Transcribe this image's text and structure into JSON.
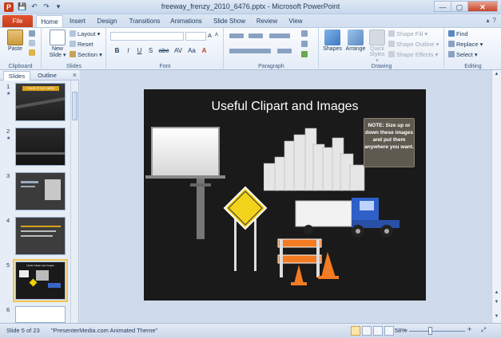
{
  "window": {
    "title": "freeway_frenzy_2010_6476.pptx - Microsoft PowerPoint",
    "app_icon": "P",
    "controls": [
      "—",
      "▢",
      "✕"
    ]
  },
  "qat": [
    "save-icon",
    "undo-icon",
    "redo-icon",
    "customize-icon"
  ],
  "tabs": {
    "file": "File",
    "items": [
      "Home",
      "Insert",
      "Design",
      "Transitions",
      "Animations",
      "Slide Show",
      "Review",
      "View"
    ],
    "active": "Home"
  },
  "ribbon": {
    "clipboard": {
      "label": "Clipboard",
      "paste": "Paste"
    },
    "slides": {
      "label": "Slides",
      "new_slide_1": "New",
      "new_slide_2": "Slide ▾",
      "layout": "Layout ▾",
      "reset": "Reset",
      "section": "Section ▾"
    },
    "font": {
      "label": "Font",
      "bold": "B",
      "italic": "I",
      "underline": "U",
      "shadow": "S",
      "strike": "abc",
      "spacing": "AV",
      "case": "Aa",
      "color": "A",
      "grow": "A",
      "shrink": "A"
    },
    "paragraph": {
      "label": "Paragraph"
    },
    "drawing": {
      "label": "Drawing",
      "shapes": "Shapes",
      "arrange": "Arrange",
      "quick_styles_1": "Quick",
      "quick_styles_2": "Styles ▾",
      "shape_fill": "Shape Fill ▾",
      "shape_outline": "Shape Outline ▾",
      "shape_effects": "Shape Effects ▾"
    },
    "editing": {
      "label": "Editing",
      "find": "Find",
      "replace": "Replace ▾",
      "select": "Select ▾"
    }
  },
  "panel": {
    "tabs": [
      "Slides",
      "Outline"
    ],
    "close": "×",
    "thumbs": [
      {
        "num": "1",
        "text": "YOUR TITLE HERE"
      },
      {
        "num": "2",
        "text": ""
      },
      {
        "num": "3",
        "text": ""
      },
      {
        "num": "4",
        "text": ""
      },
      {
        "num": "5",
        "text": "Useful Clipart and Images"
      },
      {
        "num": "6",
        "text": ""
      }
    ]
  },
  "slide": {
    "title": "Useful Clipart and Images",
    "note": "NOTE: Size up or down these images and put them anywhere you want."
  },
  "status": {
    "slide_info": "Slide 5 of 23",
    "theme": "\"PresenterMedia.com Animated Theme\"",
    "zoom": "58%",
    "minus": "−",
    "plus": "+"
  },
  "colors": {
    "file_tab": "#c43e1c",
    "ribbon_bg": "#e4ecf7",
    "slide_bg": "#1a1a1a",
    "selection": "#f2c34a"
  }
}
